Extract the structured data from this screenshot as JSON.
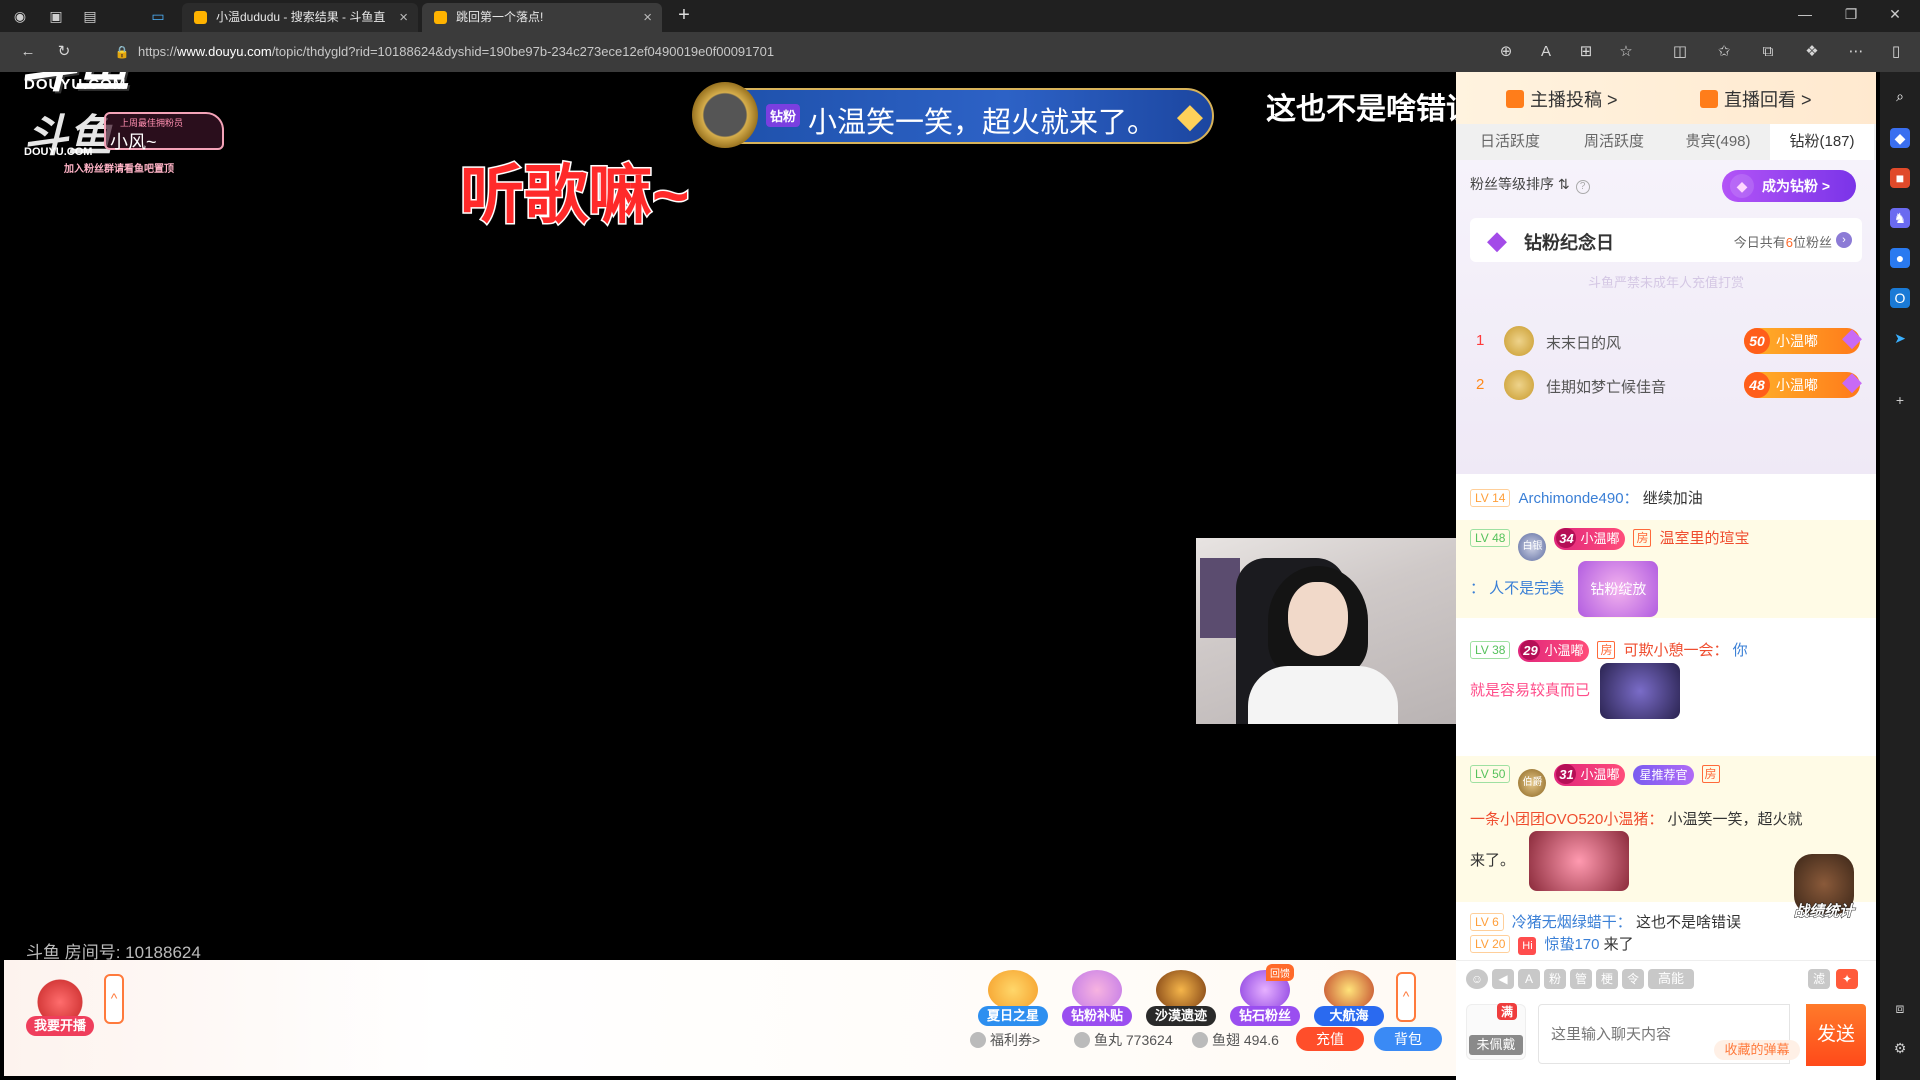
{
  "browser": {
    "tabs": [
      {
        "title": "小温dududu - 搜索结果 - 斗鱼直",
        "active": false
      },
      {
        "title": "跳回第一个落点!",
        "active": true
      }
    ],
    "url_prefix": "https://",
    "url_domain": "www.douyu.com",
    "url_path": "/topic/thdygld?rid=10188624&dyshid=190be97b-234c273ece12ef0490019e0f00091701"
  },
  "video": {
    "logo_text": "斗鱼",
    "logo_sub": "DOUYU.COM",
    "fan_badge_top": "上周最佳拥粉员",
    "fan_badge_name": "小风~",
    "fan_tip": "加入粉丝群请看鱼吧置顶",
    "song_text": "听歌嘛~",
    "banner_tag": "钻粉",
    "banner_text": "小温笑一笑，超火就来了。",
    "scroll_text": "这也不是啥错误",
    "room_number": "斗鱼 房间号: 10188624"
  },
  "bottom_bar": {
    "start_live": "我要开播",
    "activities": [
      {
        "label": "夏日之星",
        "color": "#2d8ff0"
      },
      {
        "label": "钻粉补贴",
        "color": "#9a4ef0"
      },
      {
        "label": "沙漠遗迹",
        "color": "#c76a1e"
      },
      {
        "label": "钻石粉丝",
        "color": "#9a4ef0",
        "hot": "回馈"
      },
      {
        "label": "大航海",
        "color": "#2a6af0"
      }
    ],
    "welfare": "福利券>",
    "fish_balls": "鱼丸 773624",
    "fish_fins": "鱼翅 494.6",
    "recharge": "充值",
    "backpack": "背包"
  },
  "panel": {
    "top_links": [
      "主播投稿 >",
      "直播回看 >"
    ],
    "tabs": [
      "日活跃度",
      "周活跃度",
      "贵宾(498)",
      "钻粉(187)"
    ],
    "active_tab": 3,
    "sort_label": "粉丝等级排序 ⇅",
    "become_btn": "成为钻粉 >",
    "anniversary_title": "钻粉纪念日",
    "anniversary_prefix": "今日共有",
    "anniversary_count": "6",
    "anniversary_suffix": "位粉丝",
    "watermark": "斗鱼严禁未成年人充值打赏",
    "rankings": [
      {
        "rank": "1",
        "name": "末末日的风",
        "level": "50",
        "medal": "小温嘟",
        "rank_color": "#ff3a3a"
      },
      {
        "rank": "2",
        "name": "佳期如梦亡候佳音",
        "level": "48",
        "medal": "小温嘟",
        "rank_color": "#ff8a1a"
      }
    ]
  },
  "chat": {
    "messages": [
      {
        "lv": "LV 14",
        "name": "Archimonde490：",
        "text": "继续加油"
      },
      {
        "lv": "LV 48",
        "noble": "白银",
        "medal_lv": "34",
        "medal": "小温嘟",
        "name": "温室里的瑄宝",
        "line2": "：  人不是完美",
        "sticker": "钻粉绽放"
      },
      {
        "lv": "LV 38",
        "medal_lv": "29",
        "medal": "小温嘟",
        "name": "可欺小憩一会：",
        "text_a": "你",
        "text_b": "就是容易较真而已"
      },
      {
        "lv": "LV 50",
        "noble": "伯爵",
        "medal_lv": "31",
        "medal": "小温嘟",
        "star": "星推荐官",
        "name": "一条小团团OVO520小温猪：",
        "text": "小温笑一笑，超火就",
        "text2": "来了。"
      },
      {
        "lv": "LV 6",
        "name": "冷猪无烟绿蜡干：",
        "text": "这也不是啥错误"
      },
      {
        "lv": "LV 20",
        "hi": "Hi",
        "name": "惊蛰170",
        "text": " 来了"
      }
    ],
    "stat_label": "战绩统计",
    "tool_high": "高能",
    "tool_filter": "滤",
    "not_worn_full": "满",
    "not_worn": "未佩戴",
    "input_placeholder": "这里输入聊天内容",
    "fav_barrage": "收藏的弹幕",
    "send": "发送"
  },
  "fang_label": "房"
}
